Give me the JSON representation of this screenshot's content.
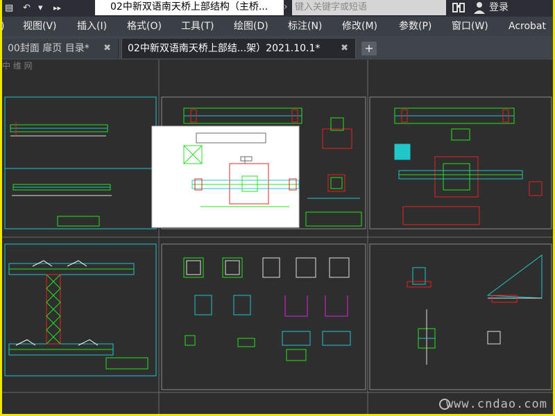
{
  "titlebar": {
    "document_title": "02中新双语南天桥上部结构（主桥...",
    "search_placeholder": "键入关键字或短语",
    "login_label": "登录",
    "forward_label": "▸▸",
    "undo_label": "↶",
    "arrow_label": "▾"
  },
  "menu": {
    "items": [
      "视图(V)",
      "插入(I)",
      "格式(O)",
      "工具(T)",
      "绘图(D)",
      "标注(N)",
      "修改(M)",
      "参数(P)",
      "窗口(W)",
      "Acrobat"
    ]
  },
  "tabs": {
    "items": [
      {
        "label": "00封面 扉页 目录*",
        "active": false
      },
      {
        "label": "02中新双语南天桥上部结...架）2021.10.1*",
        "active": true
      }
    ],
    "close_glyph": "✖",
    "add_glyph": "+"
  },
  "canvas": {
    "watermark": "中 维 网",
    "site_text": "www.cndao.com"
  },
  "colors": {
    "frame": "#f2e600",
    "cad_green": "#27e21e",
    "cad_cyan": "#1fc7c9",
    "cad_red": "#e82020",
    "cad_magenta": "#e020e0"
  }
}
